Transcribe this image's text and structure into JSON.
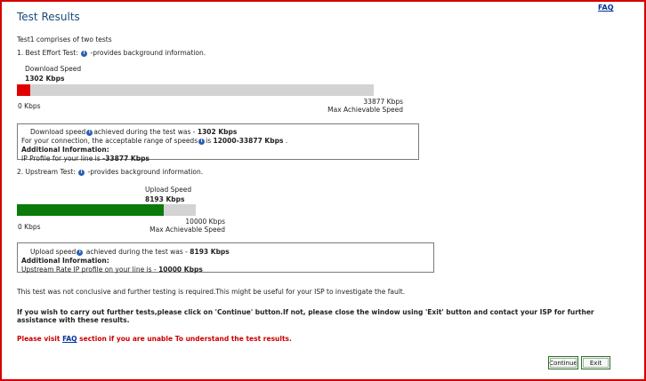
{
  "header": {
    "title": "Test Results",
    "faq_link": "FAQ"
  },
  "intro": "Test1 comprises of two tests",
  "test1": {
    "label": "1. Best Effort Test:",
    "desc": "-provides background information.",
    "meter_title": "Download Speed",
    "meter_value": "1302 Kbps",
    "measured_kbps": 1302,
    "max_kbps": 33877,
    "fill_color": "#e00000",
    "min_label": "0 Kbps",
    "max_label": "33877 Kbps",
    "max_caption": "Max Achievable Speed",
    "info": {
      "line1_prefix": "Download speed",
      "line1_mid": "achieved during the test was -",
      "line1_value": "1302 Kbps",
      "line2_prefix": "For your connection, the acceptable range of speeds",
      "line2_mid": "is",
      "line2_value": "12000-33877 Kbps",
      "line2_suffix": ".",
      "additional_heading": "Additional Information:",
      "line4_prefix": "IP Profile for your line is",
      "line4_value": "-33877 Kbps"
    }
  },
  "test2": {
    "label": "2. Upstream Test:",
    "desc": "-provides background information.",
    "meter_title": "Upload Speed",
    "meter_value": "8193 Kbps",
    "measured_kbps": 8193,
    "max_kbps": 10000,
    "fill_color": "#0a7a0a",
    "min_label": "0 Kbps",
    "max_label": "10000 Kbps",
    "max_caption": "Max Achievable Speed",
    "info": {
      "line1_prefix": "Upload speed",
      "line1_mid": "achieved during the test was -",
      "line1_value": "8193 Kbps",
      "additional_heading": "Additional Information:",
      "line3_prefix": "Upstream Rate IP profile on your line is -",
      "line3_value": "10000 Kbps"
    }
  },
  "notes": {
    "inconclusive": "This test was not conclusive and further testing is required.This might be useful for your ISP to investigate the fault.",
    "further": "If you wish to carry out further tests,please click on 'Continue' button.If not, please close the window using 'Exit' button and contact your ISP for further assistance with these results.",
    "faq_prefix": "Please visit",
    "faq_link": "FAQ",
    "faq_suffix": "section if you are unable To understand the test results."
  },
  "buttons": {
    "continue": "Continue",
    "exit": "Exit"
  },
  "icons": {
    "info": "info-icon"
  },
  "colors": {
    "frame": "#d40000",
    "title": "#1a4a7a",
    "link": "#003399",
    "warning": "#cc0000"
  }
}
